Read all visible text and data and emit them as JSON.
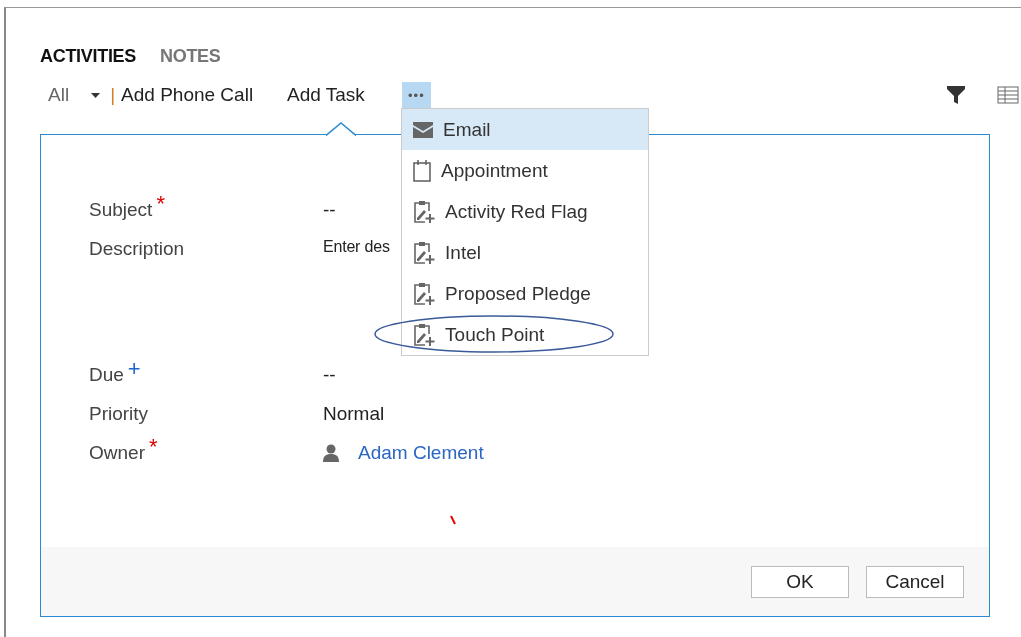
{
  "tabs": [
    {
      "label": "ACTIVITIES",
      "selected": true
    },
    {
      "label": "NOTES",
      "selected": false
    }
  ],
  "toolbar": {
    "view": "All",
    "separator": "|",
    "actions": [
      "Add Phone Call",
      "Add Task"
    ],
    "more": {
      "label": "•••",
      "open": true
    }
  },
  "menu": [
    {
      "label": "Email",
      "kind": "mail",
      "selected": true
    },
    {
      "label": "Appointment",
      "kind": "calendar",
      "selected": false
    },
    {
      "label": "Activity Red Flag",
      "kind": "task",
      "selected": false
    },
    {
      "label": "Intel",
      "kind": "task",
      "selected": false
    },
    {
      "label": "Proposed Pledge",
      "kind": "task",
      "selected": false
    },
    {
      "label": "Touch Point",
      "kind": "task",
      "selected": false,
      "circled": true
    }
  ],
  "fields": [
    {
      "label": "Subject",
      "marker": "*",
      "color": "#e00000",
      "value": "--",
      "kind": "text"
    },
    {
      "label": "Description",
      "value": "Enter des",
      "kind": "multiline"
    },
    {
      "label": "Due",
      "marker": "+",
      "color": "#2266cc",
      "value": "--",
      "kind": "text"
    },
    {
      "label": "Priority",
      "value": "Normal",
      "kind": "text"
    },
    {
      "label": "Owner",
      "marker": "*",
      "color": "#e00000",
      "value": "Adam Clement",
      "kind": "lookup"
    }
  ],
  "buttons": [
    "OK",
    "Cancel"
  ]
}
